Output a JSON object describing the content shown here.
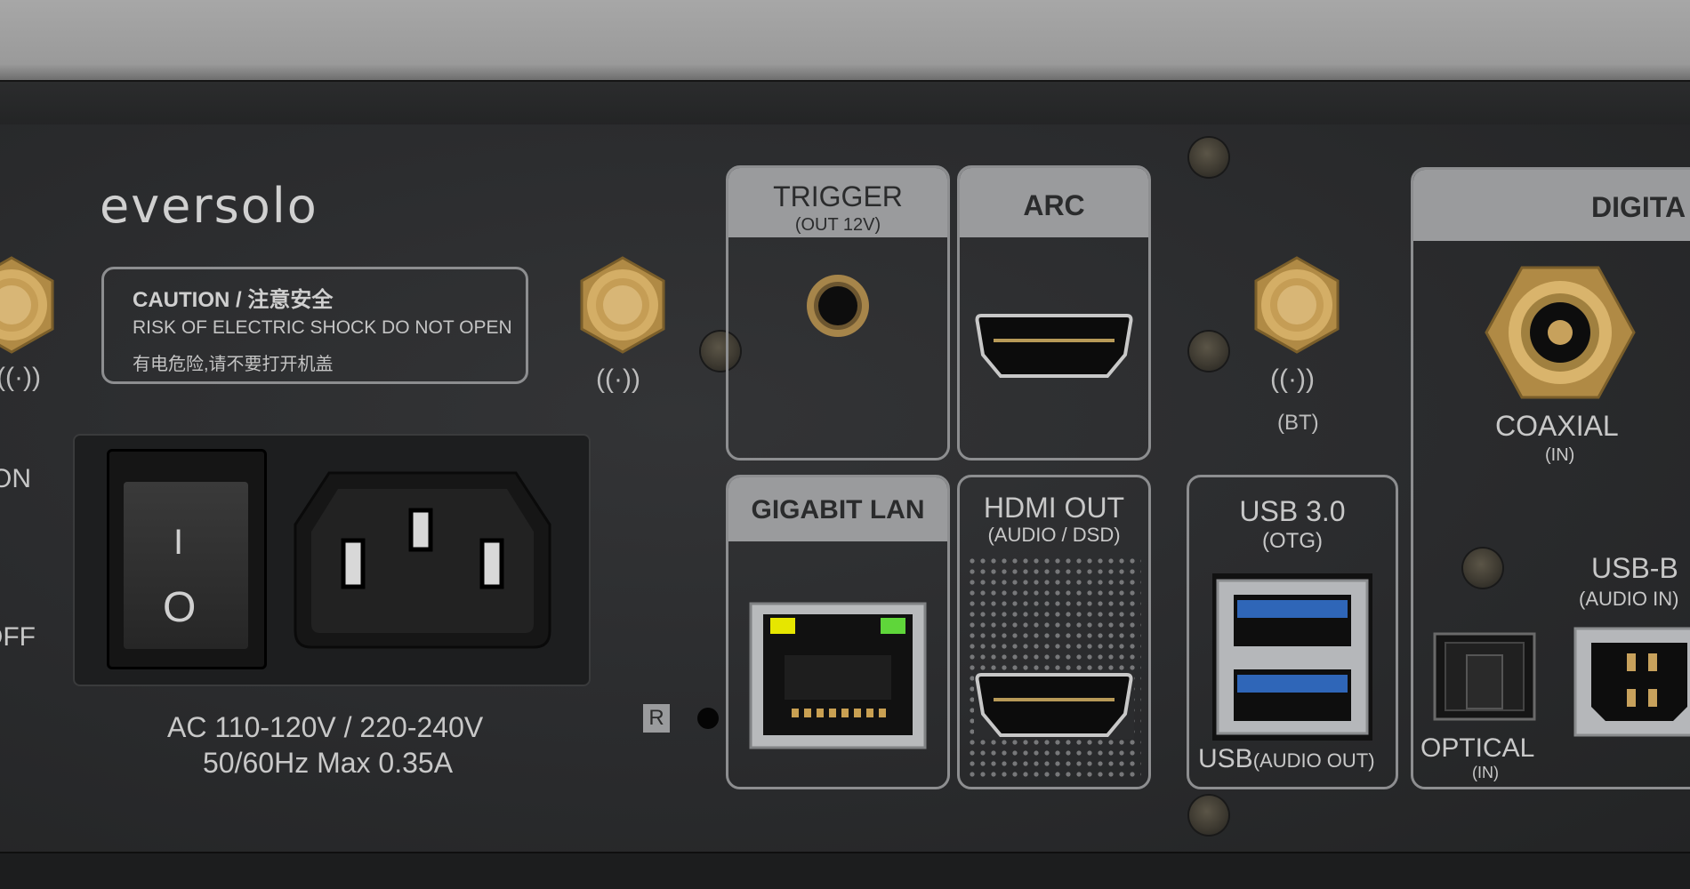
{
  "brand": {
    "logo": "eversolo"
  },
  "caution": {
    "title_en": "CAUTION",
    "title_sep": " / ",
    "title_cn": "注意安全",
    "line1": "RISK OF ELECTRIC SHOCK DO NOT OPEN",
    "line2": "有电危险,请不要打开机盖"
  },
  "power": {
    "on": "ON",
    "off": "OFF",
    "switch_on_symbol": "I",
    "switch_off_symbol": "O",
    "rating1": "AC 110-120V / 220-240V",
    "rating2": "50/60Hz Max 0.35A"
  },
  "ports": {
    "trigger": {
      "title": "TRIGGER",
      "sub": "(OUT 12V)"
    },
    "arc": {
      "title": "ARC"
    },
    "lan": {
      "title": "GIGABIT LAN"
    },
    "hdmi_out": {
      "title": "HDMI OUT",
      "sub": "(AUDIO / DSD)"
    },
    "usb3": {
      "title": "USB 3.0",
      "sub": "(OTG)",
      "footer_main": "USB",
      "footer_sub": "(AUDIO OUT)"
    },
    "bt": {
      "label": "(BT)"
    },
    "digital": {
      "title": "DIGITA"
    },
    "coaxial": {
      "title": "COAXIAL",
      "sub": "(IN)"
    },
    "optical": {
      "title": "OPTICAL",
      "sub": "(IN)"
    },
    "usbb": {
      "title": "USB-B",
      "sub": "(AUDIO IN)"
    }
  },
  "reset": {
    "label": "R"
  },
  "icons": [
    "antenna-icon",
    "hdmi-port-icon",
    "ethernet-port-icon",
    "usb-a-port-icon",
    "rca-port-icon",
    "optical-port-icon",
    "usb-b-port-icon"
  ],
  "colors": {
    "panel": "#2b2c2e",
    "label_bg": "#9a9b9d",
    "gold": "#c9a15a",
    "usb_blue": "#2f66b8",
    "led_yellow": "#e6e600",
    "led_green": "#5fd63a"
  }
}
